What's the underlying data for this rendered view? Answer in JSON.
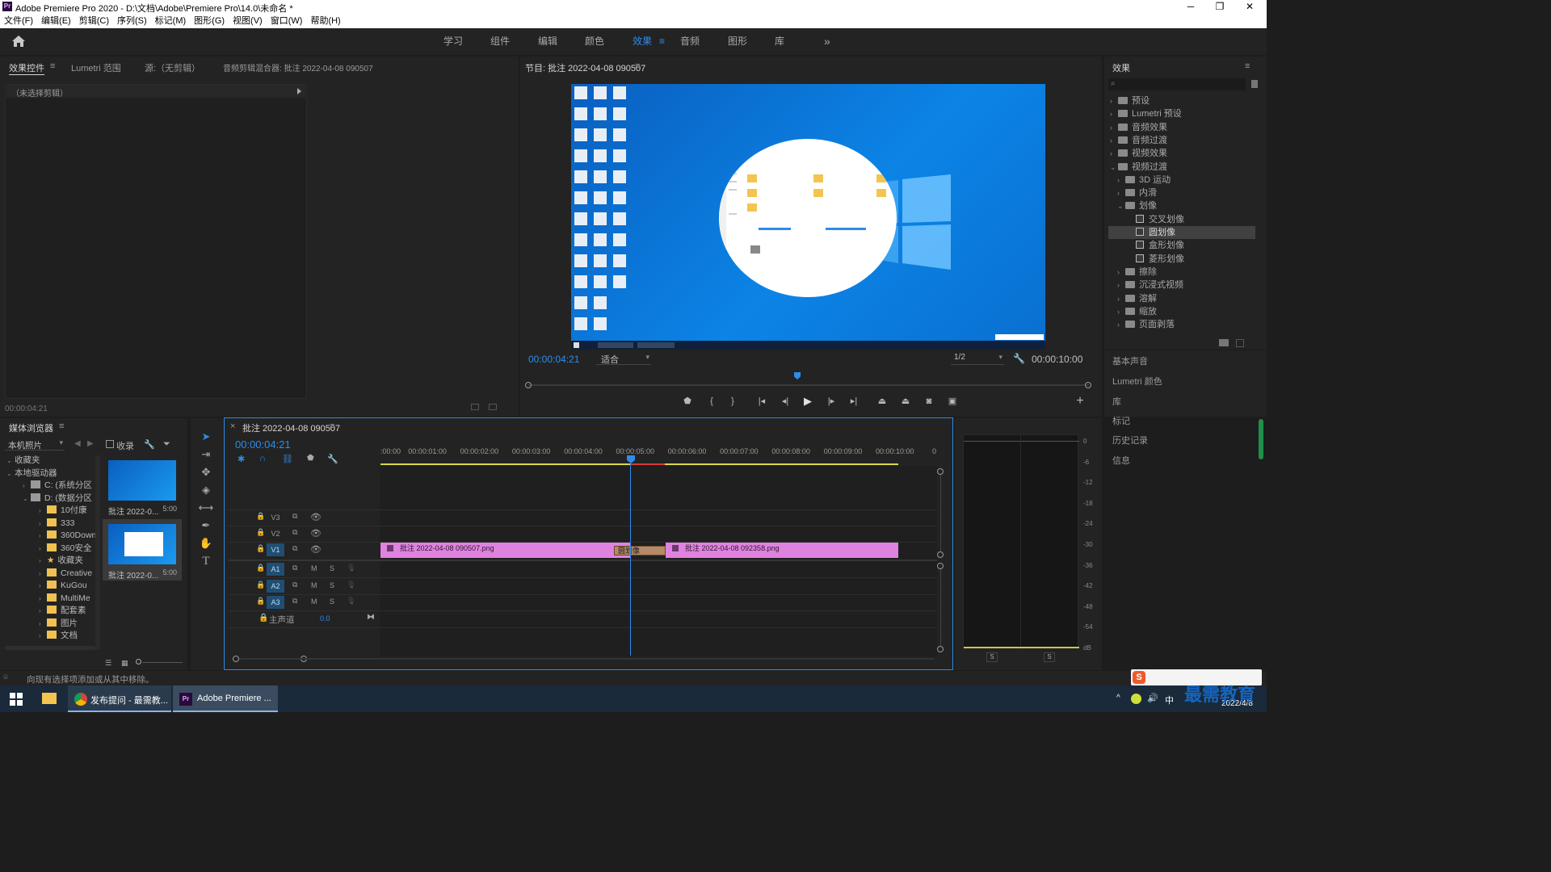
{
  "window": {
    "title": "Adobe Premiere Pro 2020 - D:\\文档\\Adobe\\Premiere Pro\\14.0\\未命名 *",
    "app_icon": "Pr",
    "min": "─",
    "max": "❐",
    "close": "✕"
  },
  "menu": [
    "文件(F)",
    "编辑(E)",
    "剪辑(C)",
    "序列(S)",
    "标记(M)",
    "图形(G)",
    "视图(V)",
    "窗口(W)",
    "帮助(H)"
  ],
  "workspaces": {
    "items": [
      "学习",
      "组件",
      "编辑",
      "颜色",
      "效果",
      "音频",
      "图形",
      "库"
    ],
    "active": "效果",
    "active_menu": "≡",
    "more": "»"
  },
  "source_panel": {
    "tabs": [
      "效果控件",
      "Lumetri 范围",
      "源:（无剪辑）",
      "音频剪辑混合器: 批注 2022-04-08 090507"
    ],
    "tab_menu": "≡",
    "no_clip": "（未选择剪辑）",
    "timecode": "00:00:04:21"
  },
  "program": {
    "title": "节目: 批注 2022-04-08 090507",
    "menu": "≡",
    "timecode": "00:00:04:21",
    "fit": "适合",
    "resolution": "1/2",
    "duration": "00:00:10:00",
    "add": "+"
  },
  "effects": {
    "title": "效果",
    "menu": "≡",
    "search_placeholder": "",
    "tree": [
      {
        "label": "预设",
        "level": 0,
        "type": "folder"
      },
      {
        "label": "Lumetri 预设",
        "level": 0,
        "type": "folder"
      },
      {
        "label": "音频效果",
        "level": 0,
        "type": "folder"
      },
      {
        "label": "音频过渡",
        "level": 0,
        "type": "folder"
      },
      {
        "label": "视频效果",
        "level": 0,
        "type": "folder"
      },
      {
        "label": "视频过渡",
        "level": 0,
        "type": "folder",
        "open": true
      },
      {
        "label": "3D 运动",
        "level": 1,
        "type": "folder"
      },
      {
        "label": "内滑",
        "level": 1,
        "type": "folder"
      },
      {
        "label": "划像",
        "level": 1,
        "type": "folder",
        "open": true
      },
      {
        "label": "交叉划像",
        "level": 2,
        "type": "fx"
      },
      {
        "label": "圆划像",
        "level": 2,
        "type": "fx",
        "selected": true
      },
      {
        "label": "盒形划像",
        "level": 2,
        "type": "fx"
      },
      {
        "label": "菱形划像",
        "level": 2,
        "type": "fx"
      },
      {
        "label": "擦除",
        "level": 1,
        "type": "folder"
      },
      {
        "label": "沉浸式视频",
        "level": 1,
        "type": "folder"
      },
      {
        "label": "溶解",
        "level": 1,
        "type": "folder"
      },
      {
        "label": "缩放",
        "level": 1,
        "type": "folder"
      },
      {
        "label": "页面剥落",
        "level": 1,
        "type": "folder"
      }
    ],
    "side_panels": [
      "基本声音",
      "Lumetri 颜色",
      "库",
      "标记",
      "历史记录",
      "信息"
    ]
  },
  "media_browser": {
    "title": "媒体浏览器",
    "menu": "≡",
    "source": "本机照片",
    "favorites_label": "收录",
    "tree": [
      {
        "label": "收藏夹",
        "level": 0
      },
      {
        "label": "本地驱动器",
        "level": 0
      },
      {
        "label": "C: (系统分区",
        "level": 1
      },
      {
        "label": "D: (数据分区",
        "level": 1
      },
      {
        "label": "10付康",
        "level": 2
      },
      {
        "label": "333",
        "level": 2
      },
      {
        "label": "360Down",
        "level": 2
      },
      {
        "label": "360安全",
        "level": 2
      },
      {
        "label": "收藏夹",
        "level": 2,
        "star": true
      },
      {
        "label": "Creative",
        "level": 2
      },
      {
        "label": "KuGou",
        "level": 2
      },
      {
        "label": "MultiMe",
        "level": 2
      },
      {
        "label": "配套素",
        "level": 2
      },
      {
        "label": "图片",
        "level": 2
      },
      {
        "label": "文档",
        "level": 2
      }
    ],
    "thumbs": [
      {
        "name": "批注 2022-0...",
        "dur": "5:00"
      },
      {
        "name": "批注 2022-0...",
        "dur": "5:00"
      }
    ]
  },
  "timeline": {
    "title": "批注 2022-04-08 090507",
    "close": "×",
    "menu": "≡",
    "timecode": "00:00:04:21",
    "ruler": [
      ":00:00",
      "00:00:01:00",
      "00:00:02:00",
      "00:00:03:00",
      "00:00:04:00",
      "00:00:05:00",
      "00:00:06:00",
      "00:00:07:00",
      "00:00:08:00",
      "00:00:09:00",
      "00:00:10:00",
      "0"
    ],
    "video_tracks": [
      "V3",
      "V2",
      "V1"
    ],
    "audio_tracks": [
      "A1",
      "A2",
      "A3"
    ],
    "master": {
      "label": "主声道",
      "value": "0.0"
    },
    "clips": [
      {
        "name": "批注 2022-04-08 090507.png"
      },
      {
        "name": "批注 2022-04-08 092358.png"
      }
    ],
    "transition": "圆划像",
    "mute": "M",
    "solo": "S"
  },
  "audio_meter": {
    "scale": [
      "0",
      "-6",
      "-12",
      "-18",
      "-24",
      "-30",
      "-36",
      "-42",
      "-48",
      "-54",
      "dB"
    ],
    "solo": [
      "S",
      "S"
    ]
  },
  "status": {
    "text": "向现有选择项添加或从其中移除。"
  },
  "taskbar": {
    "apps": [
      "发布提问 - 最需教...",
      "Adobe Premiere ..."
    ],
    "date": "2022/4/8",
    "ime": "中",
    "watermark": "最需教育"
  },
  "colors": {
    "accent": "#2d8ceb",
    "clip": "#e082e0",
    "playhead": "#2d8ceb",
    "desktop": "#0a78d8"
  }
}
